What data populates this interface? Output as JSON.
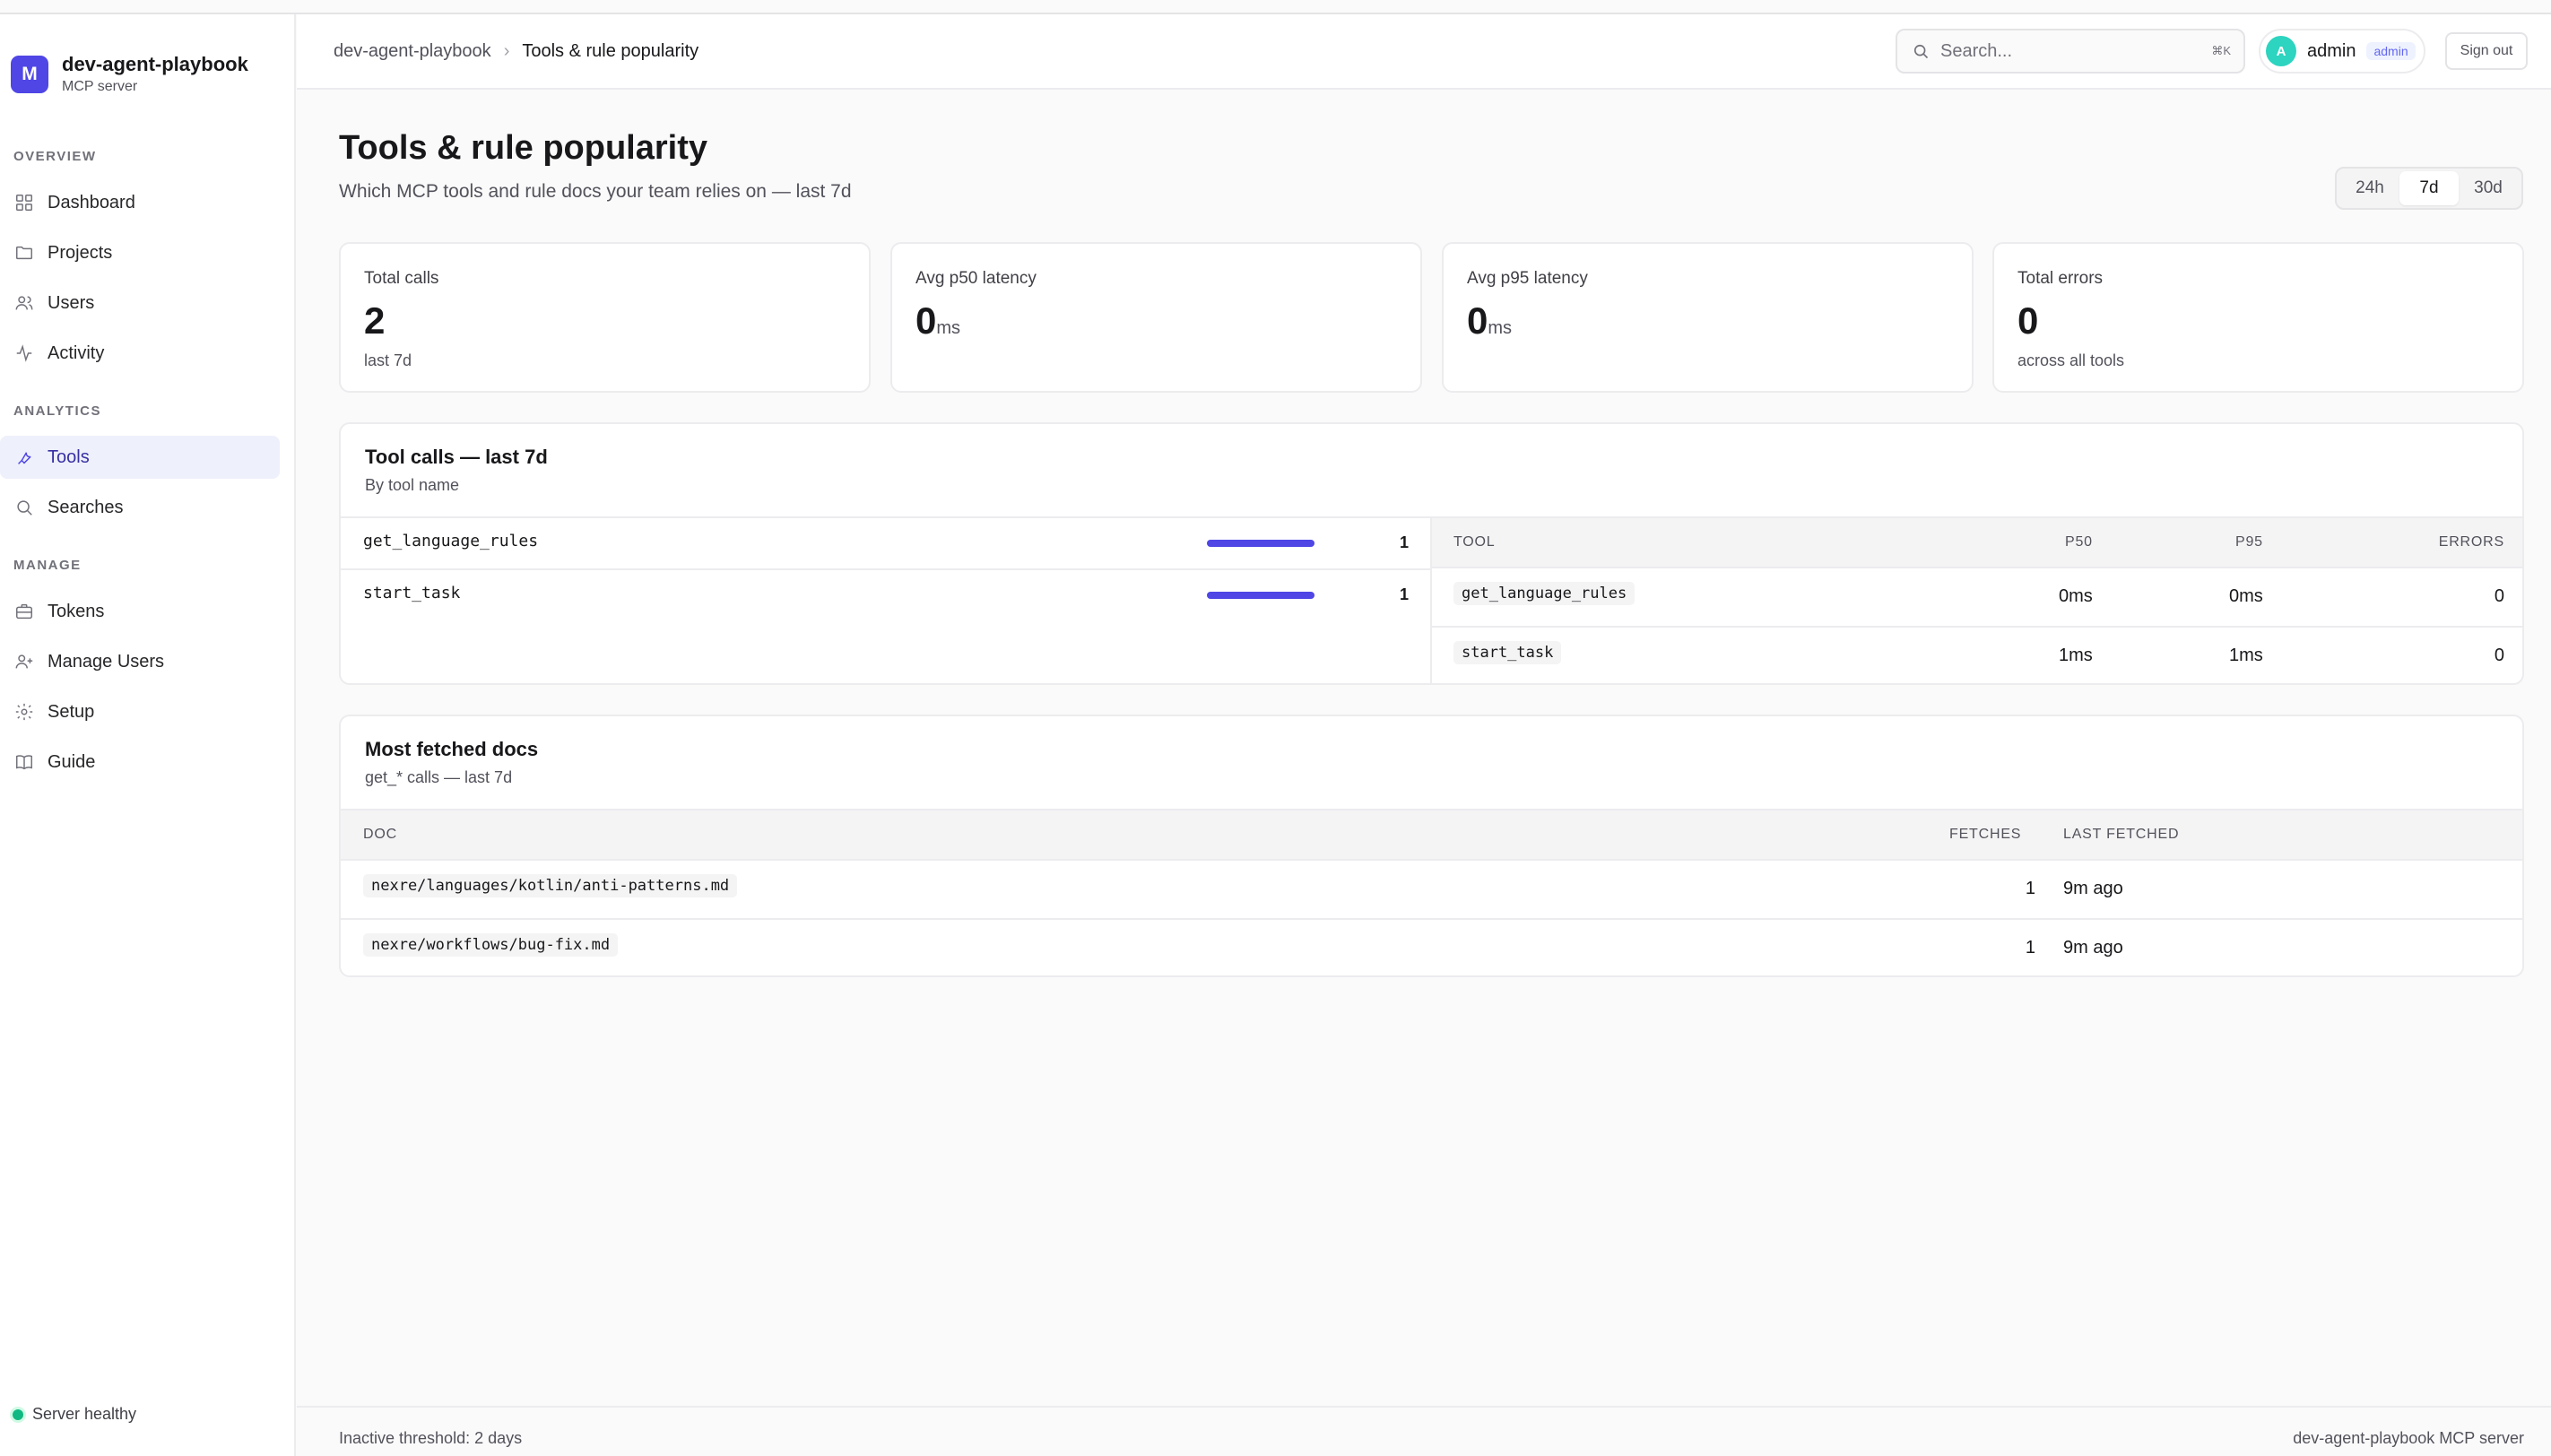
{
  "app": {
    "name": "dev-agent-playbook",
    "subtitle": "MCP server",
    "logo_letter": "M"
  },
  "sidebar": {
    "sections": {
      "overview": "OVERVIEW",
      "analytics": "ANALYTICS",
      "manage": "MANAGE"
    },
    "items": [
      {
        "label": "Dashboard",
        "icon": "dashboard-icon"
      },
      {
        "label": "Projects",
        "icon": "folder-icon"
      },
      {
        "label": "Users",
        "icon": "users-icon"
      },
      {
        "label": "Activity",
        "icon": "activity-icon"
      },
      {
        "label": "Tools",
        "icon": "wrench-icon",
        "active": true
      },
      {
        "label": "Searches",
        "icon": "search-icon"
      },
      {
        "label": "Tokens",
        "icon": "briefcase-icon"
      },
      {
        "label": "Manage Users",
        "icon": "user-plus-icon"
      },
      {
        "label": "Setup",
        "icon": "gear-icon"
      },
      {
        "label": "Guide",
        "icon": "book-icon"
      }
    ],
    "status": "Server healthy"
  },
  "header": {
    "breadcrumb": [
      "dev-agent-playbook",
      "Tools & rule popularity"
    ],
    "search_placeholder": "Search...",
    "search_shortcut": "⌘K",
    "user": {
      "initial": "A",
      "name": "admin",
      "role": "admin"
    },
    "signout_label": "Sign out"
  },
  "page": {
    "title": "Tools & rule popularity",
    "subtitle": "Which MCP tools and rule docs your team relies on — last 7d",
    "ranges": [
      "24h",
      "7d",
      "30d"
    ],
    "active_range": "7d"
  },
  "stats": [
    {
      "label": "Total calls",
      "value": "2",
      "unit": "",
      "foot": "last 7d"
    },
    {
      "label": "Avg p50 latency",
      "value": "0",
      "unit": "ms",
      "foot": ""
    },
    {
      "label": "Avg p95 latency",
      "value": "0",
      "unit": "ms",
      "foot": ""
    },
    {
      "label": "Total errors",
      "value": "0",
      "unit": "",
      "foot": "across all tools"
    }
  ],
  "tool_calls": {
    "title": "Tool calls — last 7d",
    "subtitle": "By tool name",
    "bars": [
      {
        "name": "get_language_rules",
        "value": 1,
        "fraction": 1.0
      },
      {
        "name": "start_task",
        "value": 1,
        "fraction": 1.0
      }
    ],
    "table": {
      "headers": [
        "TOOL",
        "P50",
        "P95",
        "ERRORS"
      ],
      "rows": [
        {
          "tool": "get_language_rules",
          "p50": "0ms",
          "p95": "0ms",
          "errors": "0"
        },
        {
          "tool": "start_task",
          "p50": "1ms",
          "p95": "1ms",
          "errors": "0"
        }
      ]
    }
  },
  "docs": {
    "title": "Most fetched docs",
    "subtitle": "get_* calls — last 7d",
    "headers": [
      "DOC",
      "FETCHES",
      "LAST FETCHED"
    ],
    "rows": [
      {
        "doc": "nexre/languages/kotlin/anti-patterns.md",
        "fetches": "1",
        "last": "9m ago"
      },
      {
        "doc": "nexre/workflows/bug-fix.md",
        "fetches": "1",
        "last": "9m ago"
      }
    ]
  },
  "footer": {
    "left": "Inactive threshold: 2 days",
    "right": "dev-agent-playbook MCP server"
  },
  "colors": {
    "accent": "#4f46e5",
    "healthy": "#10b981"
  }
}
